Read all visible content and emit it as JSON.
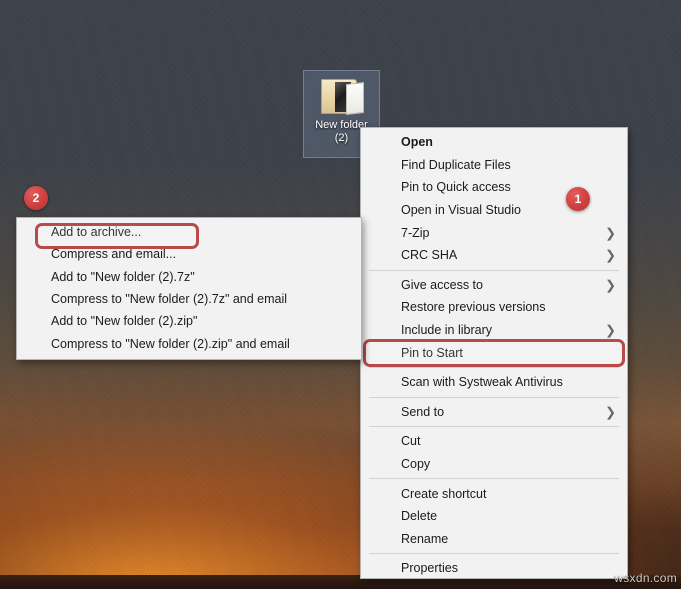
{
  "desktop": {
    "icon": {
      "name": "folder-icon",
      "label_line1": "New folder",
      "label_line2": "(2)"
    },
    "watermark": "wsxdn.com",
    "wallpaper_colors": {
      "sky": "#3b4048",
      "glow": "#ff8c28",
      "base": "#241610"
    }
  },
  "badges": [
    {
      "id": "1",
      "label": "1"
    },
    {
      "id": "2",
      "label": "2"
    }
  ],
  "main_menu": {
    "name": "file-context-menu",
    "items": [
      {
        "label": "Open",
        "bold": true,
        "arrow": false,
        "icon": null
      },
      {
        "label": "Find Duplicate Files",
        "bold": false,
        "arrow": false,
        "icon": null
      },
      {
        "label": "Pin to Quick access",
        "bold": false,
        "arrow": false,
        "icon": null
      },
      {
        "label": "Open in Visual Studio",
        "bold": false,
        "arrow": false,
        "icon": null
      },
      {
        "label": "7-Zip",
        "bold": false,
        "arrow": true,
        "icon": null,
        "highlighted": true
      },
      {
        "label": "CRC SHA",
        "bold": false,
        "arrow": true,
        "icon": null
      },
      {
        "separator": true
      },
      {
        "label": "Give access to",
        "bold": false,
        "arrow": true,
        "icon": null
      },
      {
        "label": "Restore previous versions",
        "bold": false,
        "arrow": false,
        "icon": null
      },
      {
        "label": "Include in library",
        "bold": false,
        "arrow": true,
        "icon": null
      },
      {
        "label": "Pin to Start",
        "bold": false,
        "arrow": false,
        "icon": null
      },
      {
        "separator": true
      },
      {
        "label": "Scan with Systweak Antivirus",
        "bold": false,
        "arrow": false,
        "icon": "shield-icon"
      },
      {
        "separator": true
      },
      {
        "label": "Send to",
        "bold": false,
        "arrow": true,
        "icon": null
      },
      {
        "separator": true
      },
      {
        "label": "Cut",
        "bold": false,
        "arrow": false,
        "icon": null
      },
      {
        "label": "Copy",
        "bold": false,
        "arrow": false,
        "icon": null
      },
      {
        "separator": true
      },
      {
        "label": "Create shortcut",
        "bold": false,
        "arrow": false,
        "icon": null
      },
      {
        "label": "Delete",
        "bold": false,
        "arrow": false,
        "icon": null
      },
      {
        "label": "Rename",
        "bold": false,
        "arrow": false,
        "icon": null
      },
      {
        "separator": true
      },
      {
        "label": "Properties",
        "bold": false,
        "arrow": false,
        "icon": null
      }
    ]
  },
  "submenu": {
    "name": "7zip-submenu",
    "items": [
      {
        "label": "Add to archive...",
        "highlighted": true
      },
      {
        "label": "Compress and email..."
      },
      {
        "label": "Add to \"New folder (2).7z\""
      },
      {
        "label": "Compress to \"New folder (2).7z\" and email"
      },
      {
        "label": "Add to \"New folder (2).zip\""
      },
      {
        "label": "Compress to \"New folder (2).zip\" and email"
      }
    ]
  },
  "annotation": {
    "highlight_color": "#b94a4a",
    "badge_color": "#cf3f3f"
  }
}
